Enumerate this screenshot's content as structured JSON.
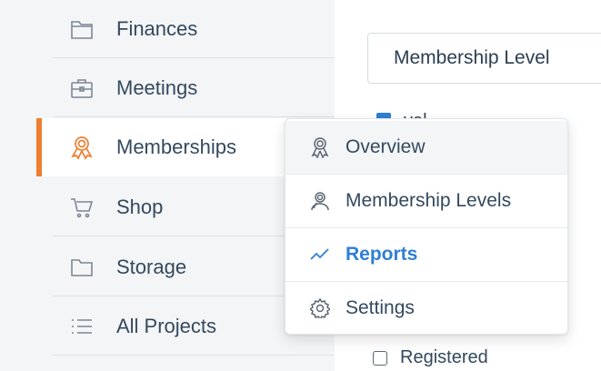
{
  "colors": {
    "accent": "#ef7d2f",
    "link_active": "#2f7fd6",
    "text": "#34495e",
    "sidebar_bg": "#f4f5f7"
  },
  "sidebar": {
    "items": [
      {
        "label": "Finances",
        "icon": "folder-icon"
      },
      {
        "label": "Meetings",
        "icon": "briefcase-icon"
      },
      {
        "label": "Memberships",
        "icon": "award-ribbon-icon",
        "active": true
      },
      {
        "label": "Shop",
        "icon": "cart-icon"
      },
      {
        "label": "Storage",
        "icon": "folder-icon"
      },
      {
        "label": "All Projects",
        "icon": "list-icon"
      }
    ]
  },
  "main": {
    "select": {
      "value": "Membership Level"
    },
    "partial_option": {
      "text": "vel"
    },
    "registered": {
      "label": "Registered"
    }
  },
  "dropdown": {
    "items": [
      {
        "label": "Overview",
        "icon": "award-ribbon-icon",
        "hover": true
      },
      {
        "label": "Membership Levels",
        "icon": "users-icon"
      },
      {
        "label": "Reports",
        "icon": "trend-line-icon",
        "current": true
      },
      {
        "label": "Settings",
        "icon": "gear-icon"
      }
    ]
  }
}
